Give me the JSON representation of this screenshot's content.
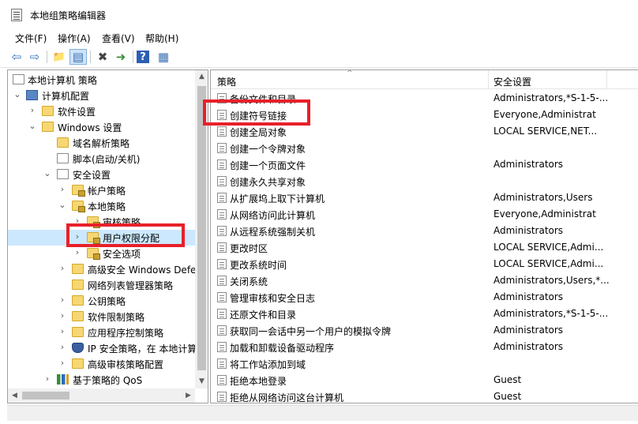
{
  "window": {
    "title": "本地组策略编辑器",
    "app_icon": "policy-editor-icon"
  },
  "menubar": [
    {
      "label": "文件(F)"
    },
    {
      "label": "操作(A)"
    },
    {
      "label": "查看(V)"
    },
    {
      "label": "帮助(H)"
    }
  ],
  "toolbar": {
    "buttons": [
      {
        "name": "back-arrow-icon",
        "glyph": "⇦"
      },
      {
        "name": "forward-arrow-icon",
        "glyph": "⇨"
      },
      {
        "name": "up-folder-icon",
        "glyph": "📁"
      },
      {
        "name": "show-hide-tree-icon",
        "glyph": "▤"
      },
      {
        "name": "delete-icon",
        "glyph": "✖"
      },
      {
        "name": "export-list-icon",
        "glyph": "➜"
      },
      {
        "name": "help-icon",
        "glyph": "?"
      },
      {
        "name": "properties-icon",
        "glyph": "▦"
      }
    ]
  },
  "tree": [
    {
      "label": "本地计算机 策略",
      "chevron": "",
      "icon": "doc"
    },
    {
      "label": "计算机配置",
      "chevron": "⌄",
      "icon": "computer"
    },
    {
      "label": "软件设置",
      "chevron": "›",
      "icon": "folder"
    },
    {
      "label": "Windows 设置",
      "chevron": "⌄",
      "icon": "folder"
    },
    {
      "label": "域名解析策略",
      "chevron": "",
      "icon": "folder"
    },
    {
      "label": "脚本(启动/关机)",
      "chevron": "",
      "icon": "doc"
    },
    {
      "label": "安全设置",
      "chevron": "⌄",
      "icon": "doc"
    },
    {
      "label": "帐户策略",
      "chevron": "›",
      "icon": "folder-lock"
    },
    {
      "label": "本地策略",
      "chevron": "⌄",
      "icon": "folder-lock"
    },
    {
      "label": "审核策略",
      "chevron": "›",
      "icon": "folder-lock"
    },
    {
      "label": "用户权限分配",
      "chevron": "›",
      "icon": "folder-lock"
    },
    {
      "label": "安全选项",
      "chevron": "›",
      "icon": "folder-lock"
    },
    {
      "label": "高级安全 Windows Defe",
      "chevron": "›",
      "icon": "folder"
    },
    {
      "label": "网络列表管理器策略",
      "chevron": "",
      "icon": "folder"
    },
    {
      "label": "公钥策略",
      "chevron": "›",
      "icon": "folder"
    },
    {
      "label": "软件限制策略",
      "chevron": "›",
      "icon": "folder"
    },
    {
      "label": "应用程序控制策略",
      "chevron": "›",
      "icon": "folder"
    },
    {
      "label": "IP 安全策略，在 本地计算",
      "chevron": "›",
      "icon": "shield"
    },
    {
      "label": "高级审核策略配置",
      "chevron": "›",
      "icon": "folder"
    },
    {
      "label": "基于策略的 QoS",
      "chevron": "›",
      "icon": "chart"
    }
  ],
  "list": {
    "columns": {
      "policy": "策略",
      "security": "安全设置"
    },
    "rows": [
      {
        "policy": "备份文件和目录",
        "security": "Administrators,*S-1-5-..."
      },
      {
        "policy": "创建符号链接",
        "security": "Everyone,Administrat"
      },
      {
        "policy": "创建全局对象",
        "security": "LOCAL SERVICE,NET..."
      },
      {
        "policy": "创建一个令牌对象",
        "security": ""
      },
      {
        "policy": "创建一个页面文件",
        "security": "Administrators"
      },
      {
        "policy": "创建永久共享对象",
        "security": ""
      },
      {
        "policy": "从扩展坞上取下计算机",
        "security": "Administrators,Users"
      },
      {
        "policy": "从网络访问此计算机",
        "security": "Everyone,Administrat"
      },
      {
        "policy": "从远程系统强制关机",
        "security": "Administrators"
      },
      {
        "policy": "更改时区",
        "security": "LOCAL SERVICE,Admi..."
      },
      {
        "policy": "更改系统时间",
        "security": "LOCAL SERVICE,Admi..."
      },
      {
        "policy": "关闭系统",
        "security": "Administrators,Users,*..."
      },
      {
        "policy": "管理审核和安全日志",
        "security": "Administrators"
      },
      {
        "policy": "还原文件和目录",
        "security": "Administrators,*S-1-5-..."
      },
      {
        "policy": "获取同一会话中另一个用户的模拟令牌",
        "security": "Administrators"
      },
      {
        "policy": "加载和卸载设备驱动程序",
        "security": "Administrators"
      },
      {
        "policy": "将工作站添加到域",
        "security": ""
      },
      {
        "policy": "拒绝本地登录",
        "security": "Guest"
      },
      {
        "policy": "拒绝从网络访问这台计算机",
        "security": "Guest"
      }
    ]
  },
  "colors": {
    "highlight": "#e8202a",
    "folder": "#f7d774"
  }
}
